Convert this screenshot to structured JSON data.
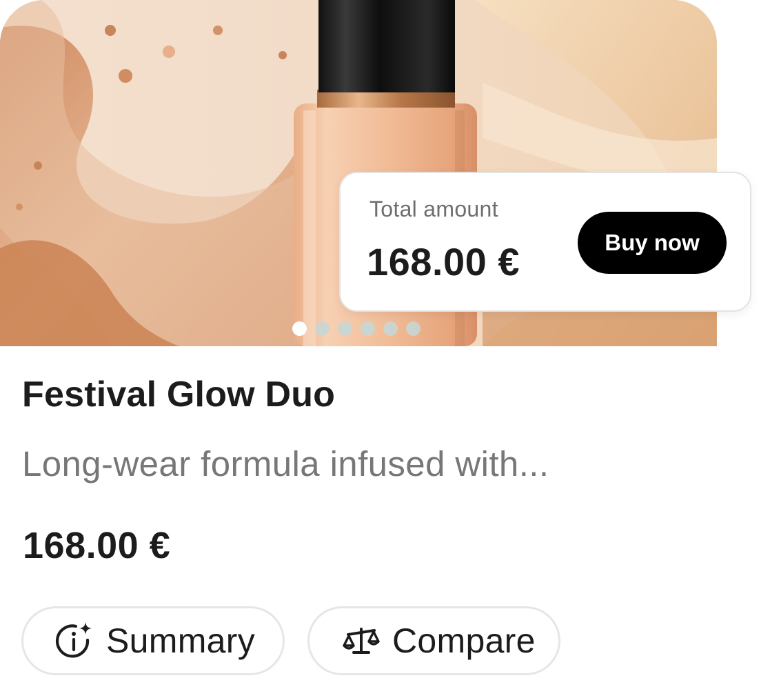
{
  "product_card": {
    "hero": {
      "image": "foundation-bottle-with-cream-swirl",
      "carousel": {
        "total": 6,
        "active": 1
      }
    },
    "price_popover": {
      "label": "Total amount",
      "amount": "168.00 €",
      "button_label": "Buy now"
    },
    "title": "Festival Glow Duo",
    "description": "Long-wear formula infused with...",
    "price": "168.00 €",
    "actions": [
      {
        "label": "Summary",
        "icon": "info-sparkle-icon"
      },
      {
        "label": "Compare",
        "icon": "scale-icon"
      }
    ]
  },
  "colors": {
    "button_bg": "#000000",
    "button_text": "#ffffff",
    "muted_text": "#777777",
    "pill_border": "#e6e6e6"
  }
}
